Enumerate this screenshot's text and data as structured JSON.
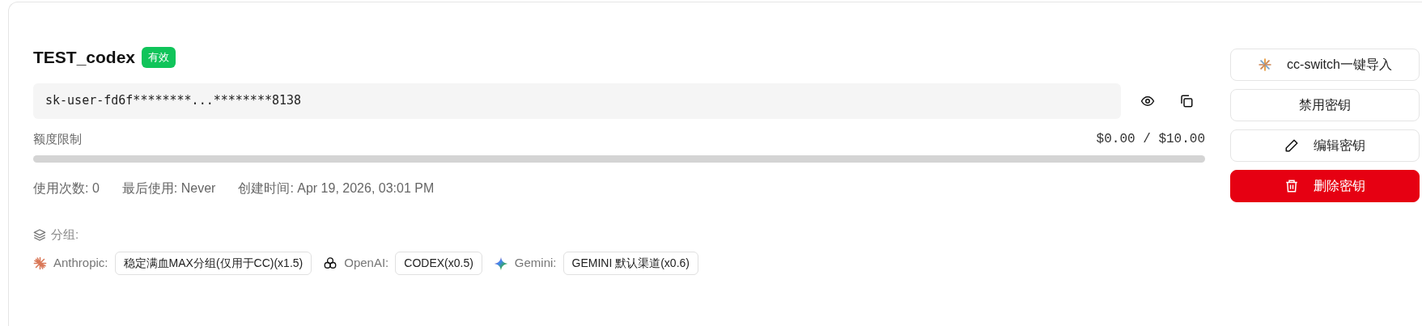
{
  "key": {
    "name": "TEST_codex",
    "status": {
      "label": "有效",
      "kind": "active"
    },
    "masked_key": "sk-user-fd6f********...********8138"
  },
  "quota": {
    "label": "额度限制",
    "reading": "$0.00 / $10.00",
    "level": 0
  },
  "stats": [
    {
      "text": "使用次数: 0"
    },
    {
      "text": "最后使用: Never"
    },
    {
      "text": "创建时间: Apr 19, 2026, 03:01 PM"
    }
  ],
  "groups": {
    "label": "分组:",
    "items": [
      {
        "kind": "anthropic",
        "provider": "Anthropic:",
        "group": "稳定满血MAX分组(仅用于CC)(x1.5)"
      },
      {
        "kind": "openai",
        "provider": "OpenAI:",
        "group": "CODEX(x0.5)"
      },
      {
        "kind": "gemini",
        "provider": "Gemini:",
        "group": "GEMINI 默认渠道(x0.6)"
      }
    ]
  },
  "actions": [
    {
      "kind": "import",
      "label": "cc-switch一键导入"
    },
    {
      "kind": "disable",
      "label": "禁用密钥"
    },
    {
      "kind": "edit",
      "label": "编辑密钥"
    },
    {
      "kind": "delete",
      "label": "删除密钥"
    }
  ]
}
